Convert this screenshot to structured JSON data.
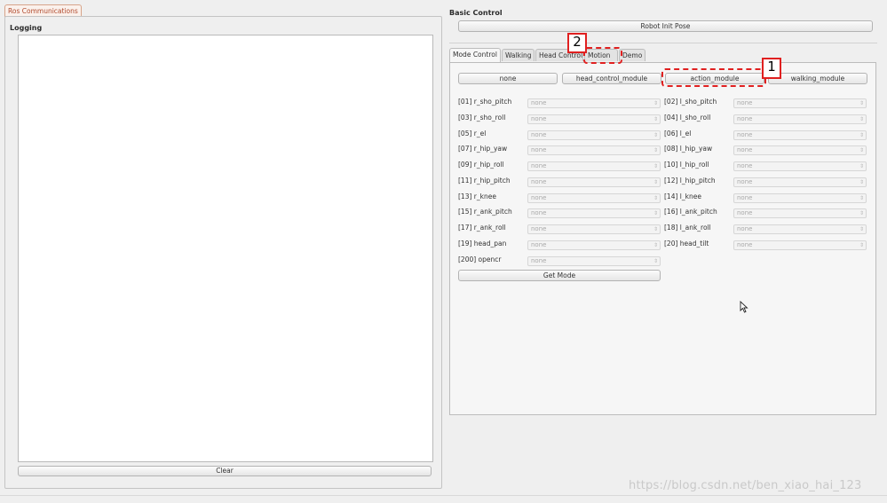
{
  "left": {
    "tab": "Ros Communications",
    "logging_title": "Logging",
    "clear_label": "Clear"
  },
  "basic_control": {
    "title": "Basic Control",
    "robot_init_pose": "Robot Init Pose"
  },
  "tabs": [
    "Mode Control",
    "Walking",
    "Head Control",
    "Motion",
    "Demo"
  ],
  "modules": [
    "none",
    "head_control_module",
    "action_module",
    "walking_module"
  ],
  "joints": [
    {
      "label": "[01] r_sho_pitch",
      "value": "none"
    },
    {
      "label": "[02] l_sho_pitch",
      "value": "none"
    },
    {
      "label": "[03] r_sho_roll",
      "value": "none"
    },
    {
      "label": "[04] l_sho_roll",
      "value": "none"
    },
    {
      "label": "[05] r_el",
      "value": "none"
    },
    {
      "label": "[06] l_el",
      "value": "none"
    },
    {
      "label": "[07] r_hip_yaw",
      "value": "none"
    },
    {
      "label": "[08] l_hip_yaw",
      "value": "none"
    },
    {
      "label": "[09] r_hip_roll",
      "value": "none"
    },
    {
      "label": "[10] l_hip_roll",
      "value": "none"
    },
    {
      "label": "[11] r_hip_pitch",
      "value": "none"
    },
    {
      "label": "[12] l_hip_pitch",
      "value": "none"
    },
    {
      "label": "[13] r_knee",
      "value": "none"
    },
    {
      "label": "[14] l_knee",
      "value": "none"
    },
    {
      "label": "[15] r_ank_pitch",
      "value": "none"
    },
    {
      "label": "[16] l_ank_pitch",
      "value": "none"
    },
    {
      "label": "[17] r_ank_roll",
      "value": "none"
    },
    {
      "label": "[18] l_ank_roll",
      "value": "none"
    },
    {
      "label": "[19] head_pan",
      "value": "none"
    },
    {
      "label": "[20] head_tilt",
      "value": "none"
    },
    {
      "label": "[200] opencr",
      "value": "none"
    }
  ],
  "get_mode_label": "Get Mode",
  "annotations": [
    "1",
    "2"
  ],
  "annotation_color": "#e02020",
  "watermark": "https://blog.csdn.net/ben_xiao_hai_123"
}
